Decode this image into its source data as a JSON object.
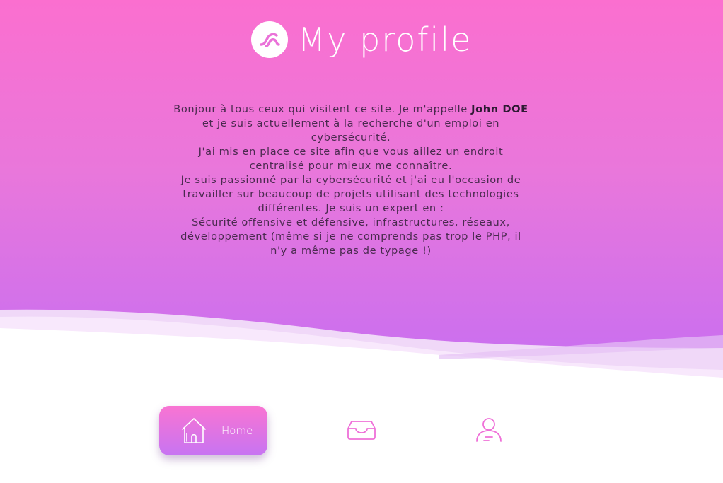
{
  "header": {
    "title": "My profile",
    "logo_icon": "brand-logo-icon"
  },
  "bio": {
    "line1_pre": "Bonjour à tous ceux qui visitent ce site. Je m'appelle",
    "name": "John DOE",
    "line1_post": "et je suis actuellement à la recherche d'un emploi en cybersécurité.",
    "para2": "J'ai mis en place ce site afin que vous aillez un endroit centralisé pour mieux me connaître.",
    "para3": "Je suis passionné par la cybersécurité et j'ai eu l'occasion de travailler sur beaucoup de projets utilisant des technologies différentes. Je suis un expert en :",
    "para4": "Sécurité offensive et défensive, infrastructures, réseaux, développement (même si je ne comprends pas trop le PHP, il n'y a même pas de typage !)"
  },
  "nav": {
    "items": [
      {
        "label": "Home",
        "icon": "home-icon",
        "active": true
      },
      {
        "label": "",
        "icon": "inbox-icon",
        "active": false
      },
      {
        "label": "",
        "icon": "user-icon",
        "active": false
      }
    ]
  },
  "colors": {
    "gradient_top": "#fb6fcf",
    "gradient_bottom": "#c66ef2",
    "accent": "#f06fd6",
    "text": "#4a2a4f"
  }
}
